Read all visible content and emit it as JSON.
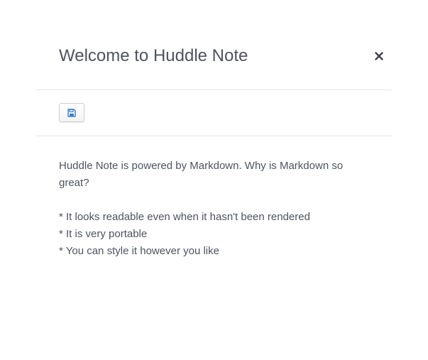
{
  "modal": {
    "title": "Welcome to Huddle Note",
    "close_icon": "close-icon",
    "toolbar": {
      "save_icon": "floppy-disk-icon",
      "accent_color": "#3a7fc4"
    },
    "body": {
      "intro": "Huddle Note is powered by Markdown. Why is Markdown so great?",
      "lines": [
        "* It looks readable even when it hasn't been rendered",
        "* It is very portable",
        "* You can style it however you like"
      ]
    }
  }
}
